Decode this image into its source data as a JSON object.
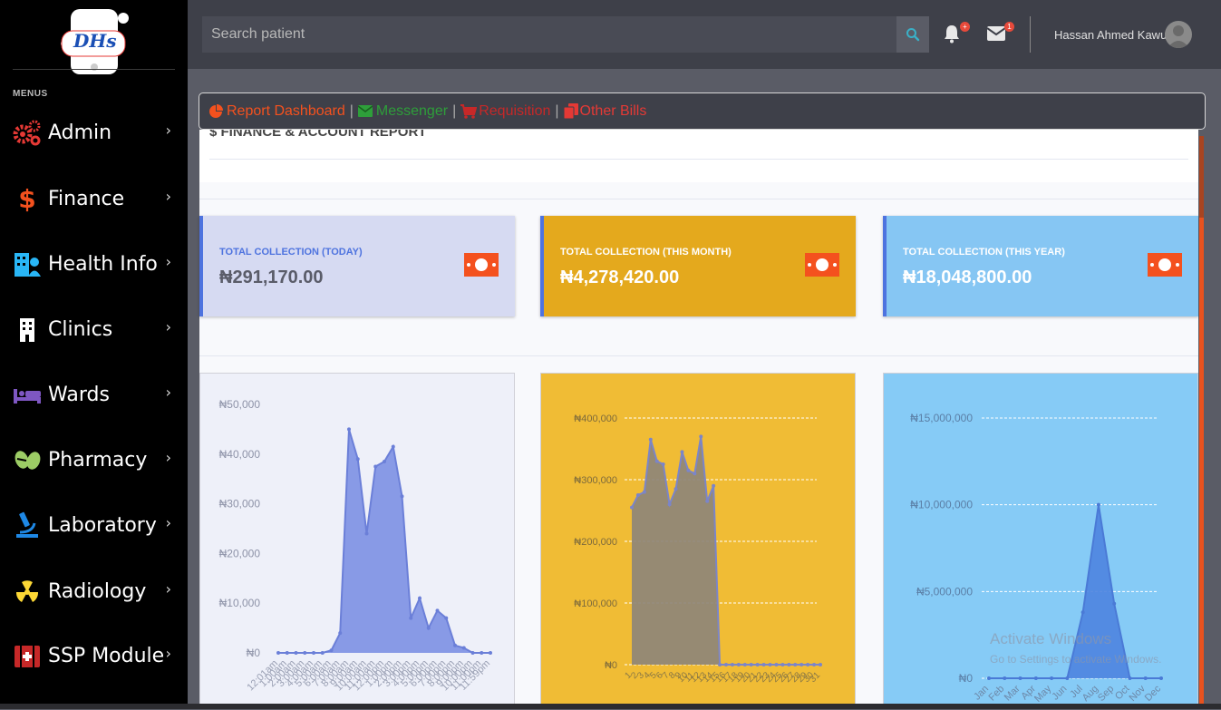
{
  "app": {
    "logo_text": "DHs"
  },
  "sidebar": {
    "menus_label": "MENUS",
    "items": [
      {
        "label": "Admin",
        "icon": "cogs-icon",
        "color": "#e53935"
      },
      {
        "label": "Finance",
        "icon": "dollar-icon",
        "color": "#f4511e"
      },
      {
        "label": "Health Info",
        "icon": "hospital-user-icon",
        "color": "#29b6f6"
      },
      {
        "label": "Clinics",
        "icon": "building-icon",
        "color": "#ffffff"
      },
      {
        "label": "Wards",
        "icon": "bed-icon",
        "color": "#7e57c2"
      },
      {
        "label": "Pharmacy",
        "icon": "pills-icon",
        "color": "#9ccc65"
      },
      {
        "label": "Laboratory",
        "icon": "microscope-icon",
        "color": "#1e88e5"
      },
      {
        "label": "Radiology",
        "icon": "radiation-icon",
        "color": "#fdd835"
      },
      {
        "label": "SSP Module",
        "icon": "first-aid-icon",
        "color": "#c62828"
      }
    ]
  },
  "topbar": {
    "search_placeholder": "Search patient",
    "alerts_count": "+",
    "messages_count": "1",
    "user_name": "Hassan Ahmed Kawu"
  },
  "quicknav": {
    "items": [
      {
        "label": "Report Dashboard",
        "icon": "chart-pie-icon",
        "color": "#f4511e"
      },
      {
        "label": "Messenger",
        "icon": "envelope-icon",
        "color": "#2e9e3a"
      },
      {
        "label": "Requisition",
        "icon": "cart-icon",
        "color": "#c62828"
      },
      {
        "label": "Other Bills",
        "icon": "copy-icon",
        "color": "#e53935"
      }
    ]
  },
  "report": {
    "title": "$ FINANCE & ACCOUNT REPORT"
  },
  "stats": [
    {
      "label": "TOTAL COLLECTION (TODAY)",
      "value": "₦291,170.00",
      "bg": "#d6daf2",
      "label_color": "#4e73df",
      "value_color": "#5a5c69",
      "icon": "money-bill-icon"
    },
    {
      "label": "TOTAL COLLECTION (THIS MONTH)",
      "value": "₦4,278,420.00",
      "bg": "#e4a91d",
      "label_color": "#ffffff",
      "value_color": "#ffffff",
      "icon": "money-bill-icon"
    },
    {
      "label": "TOTAL COLLECTION (THIS YEAR)",
      "value": "₦18,048,800.00",
      "bg": "#86c6f3",
      "label_color": "#ffffff",
      "value_color": "#ffffff",
      "icon": "money-bill-icon"
    }
  ],
  "watermark": {
    "line1": "Activate Windows",
    "line2": "Go to Settings to activate Windows."
  },
  "chart_data": [
    {
      "type": "area",
      "title": "",
      "y_tick_labels": [
        "₦0",
        "₦10,000",
        "₦20,000",
        "₦30,000",
        "₦40,000",
        "₦50,000"
      ],
      "ylim": [
        0,
        50000
      ],
      "x_tick_labels": [
        "12:01am",
        "1:00am",
        "2:00am",
        "3:00am",
        "4:00am",
        "5:00am",
        "6:00am",
        "7:00am",
        "8:00am",
        "9:00am",
        "10:00am",
        "11:00am",
        "12:00pm",
        "1:00pm",
        "2:00pm",
        "3:00pm",
        "4:00pm",
        "5:00pm",
        "6:00pm",
        "7:00pm",
        "8:00pm",
        "9:00pm",
        "10:00pm",
        "11:00pm",
        "11:59pm"
      ],
      "values": [
        0,
        0,
        0,
        0,
        0,
        0,
        500,
        4000,
        45000,
        39000,
        24000,
        37500,
        38500,
        41500,
        31500,
        7000,
        11000,
        5000,
        8500,
        7000,
        1500,
        1000,
        0,
        0,
        0
      ],
      "grid": false,
      "fill": "#7f93e4",
      "stroke": "#6b7fd8",
      "bg": "#eef0f9"
    },
    {
      "type": "area",
      "title": "",
      "y_tick_labels": [
        "₦0",
        "₦100,000",
        "₦200,000",
        "₦300,000",
        "₦400,000"
      ],
      "ylim": [
        0,
        400000
      ],
      "x_tick_labels": [
        "1",
        "2",
        "3",
        "4",
        "5",
        "6",
        "7",
        "8",
        "9",
        "10",
        "11",
        "12",
        "13",
        "14",
        "15",
        "16",
        "17",
        "18",
        "19",
        "20",
        "21",
        "22",
        "23",
        "24",
        "25",
        "26",
        "27",
        "28",
        "29",
        "30",
        "31"
      ],
      "values": [
        255000,
        275000,
        280000,
        365000,
        330000,
        325000,
        260000,
        285000,
        345000,
        315000,
        310000,
        370000,
        265000,
        290000,
        0,
        0,
        0,
        0,
        0,
        0,
        0,
        0,
        0,
        0,
        0,
        0,
        0,
        0,
        0,
        0,
        0
      ],
      "grid": true,
      "fill": "#8e8678",
      "stroke": "#7b85c9",
      "bg": "#f0bc35"
    },
    {
      "type": "area",
      "title": "",
      "y_tick_labels": [
        "₦0",
        "₦5,000,000",
        "₦10,000,000",
        "₦15,000,000"
      ],
      "ylim": [
        0,
        15000000
      ],
      "x_tick_labels": [
        "Jan",
        "Feb",
        "Mar",
        "Apr",
        "May",
        "Jun",
        "Jul",
        "Aug",
        "Sep",
        "Oct",
        "Nov",
        "Dec"
      ],
      "values": [
        0,
        0,
        0,
        0,
        0,
        0,
        3800000,
        10000000,
        4300000,
        0,
        0,
        0
      ],
      "grid": true,
      "fill": "#4f86e0",
      "stroke": "#4a7ad6",
      "bg": "#86cbf6"
    }
  ]
}
